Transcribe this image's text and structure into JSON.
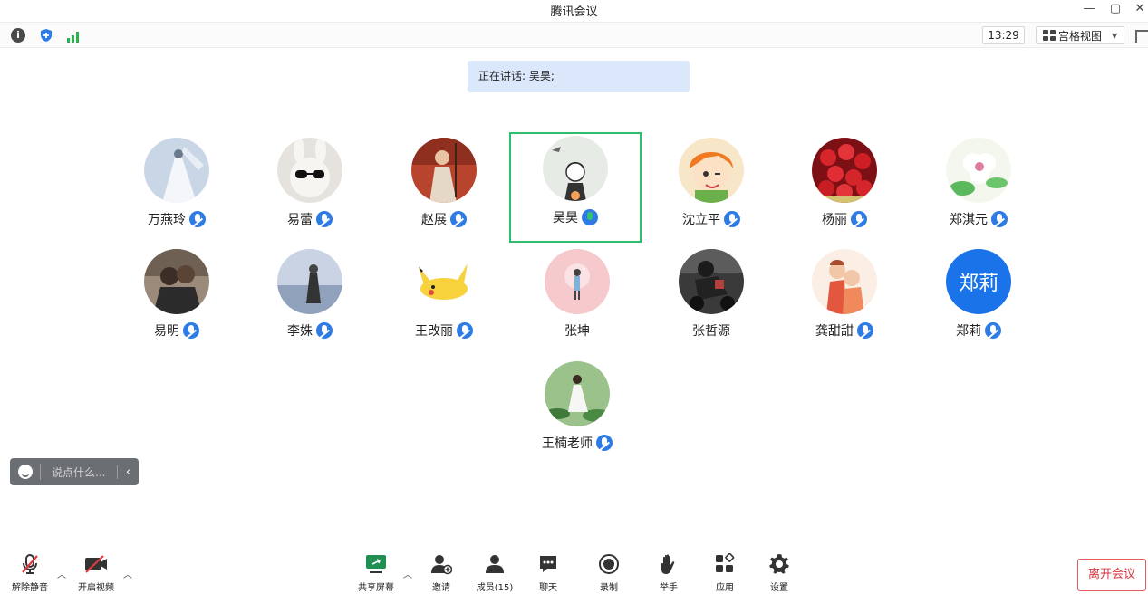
{
  "window": {
    "title": "腾讯会议"
  },
  "statusbar": {
    "time": "13:29",
    "view_mode": "宫格视图"
  },
  "speaking_banner": "正在讲话: 吴昊;",
  "participants": [
    {
      "name": "万燕玲",
      "avatar": "bride-photo",
      "mic": "muted"
    },
    {
      "name": "易蕾",
      "avatar": "bunny-sunglasses",
      "mic": "muted"
    },
    {
      "name": "赵展",
      "avatar": "woman-erhu",
      "mic": "muted"
    },
    {
      "name": "吴昊",
      "avatar": "illustration-girl",
      "mic": "speaking",
      "active": true
    },
    {
      "name": "沈立平",
      "avatar": "anime-girl-orange-hair",
      "mic": "muted"
    },
    {
      "name": "杨丽",
      "avatar": "red-roses",
      "mic": "muted"
    },
    {
      "name": "郑淇元",
      "avatar": "white-flower",
      "mic": "muted"
    },
    {
      "name": "易明",
      "avatar": "couple-photo",
      "mic": "muted"
    },
    {
      "name": "李姝",
      "avatar": "woman-seaside",
      "mic": "muted"
    },
    {
      "name": "王改丽",
      "avatar": "pikachu",
      "mic": "muted"
    },
    {
      "name": "张坤",
      "avatar": "pink-illustration",
      "mic": "none"
    },
    {
      "name": "张哲源",
      "avatar": "motorcycle-rider",
      "mic": "none"
    },
    {
      "name": "龚甜甜",
      "avatar": "hug-illustration",
      "mic": "muted"
    },
    {
      "name": "郑莉",
      "avatar": "text-avatar",
      "avatar_text": "郑莉",
      "mic": "muted"
    },
    {
      "name": "王楠老师",
      "avatar": "woman-lotus",
      "mic": "muted"
    }
  ],
  "chat": {
    "placeholder": "说点什么..."
  },
  "toolbar": {
    "unmute": "解除静音",
    "start_video": "开启视频",
    "share_screen": "共享屏幕",
    "invite": "邀请",
    "members": "成员(15)",
    "chat": "聊天",
    "record": "录制",
    "raise_hand": "举手",
    "apps": "应用",
    "settings": "设置",
    "leave": "离开会议"
  },
  "colors": {
    "accent": "#2f7be5",
    "active_border": "#2ebd6b",
    "leave": "#d9363e",
    "banner": "#dbe8fb"
  }
}
